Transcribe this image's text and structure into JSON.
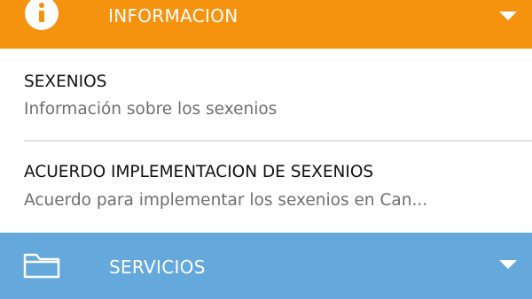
{
  "informacion": {
    "icon": "info-icon",
    "label": "INFORMACION",
    "expand_icon": "caret-down-icon",
    "color": "#F5920E"
  },
  "items": [
    {
      "title": "SEXENIOS",
      "subtitle": "Información sobre los sexenios"
    },
    {
      "title": "ACUERDO IMPLEMENTACION DE SEXENIOS",
      "subtitle": "Acuerdo para implementar los sexenios en Can..."
    }
  ],
  "servicios": {
    "icon": "folder-icon",
    "label": "SERVICIOS",
    "expand_icon": "caret-down-icon",
    "color": "#64A8DC"
  }
}
